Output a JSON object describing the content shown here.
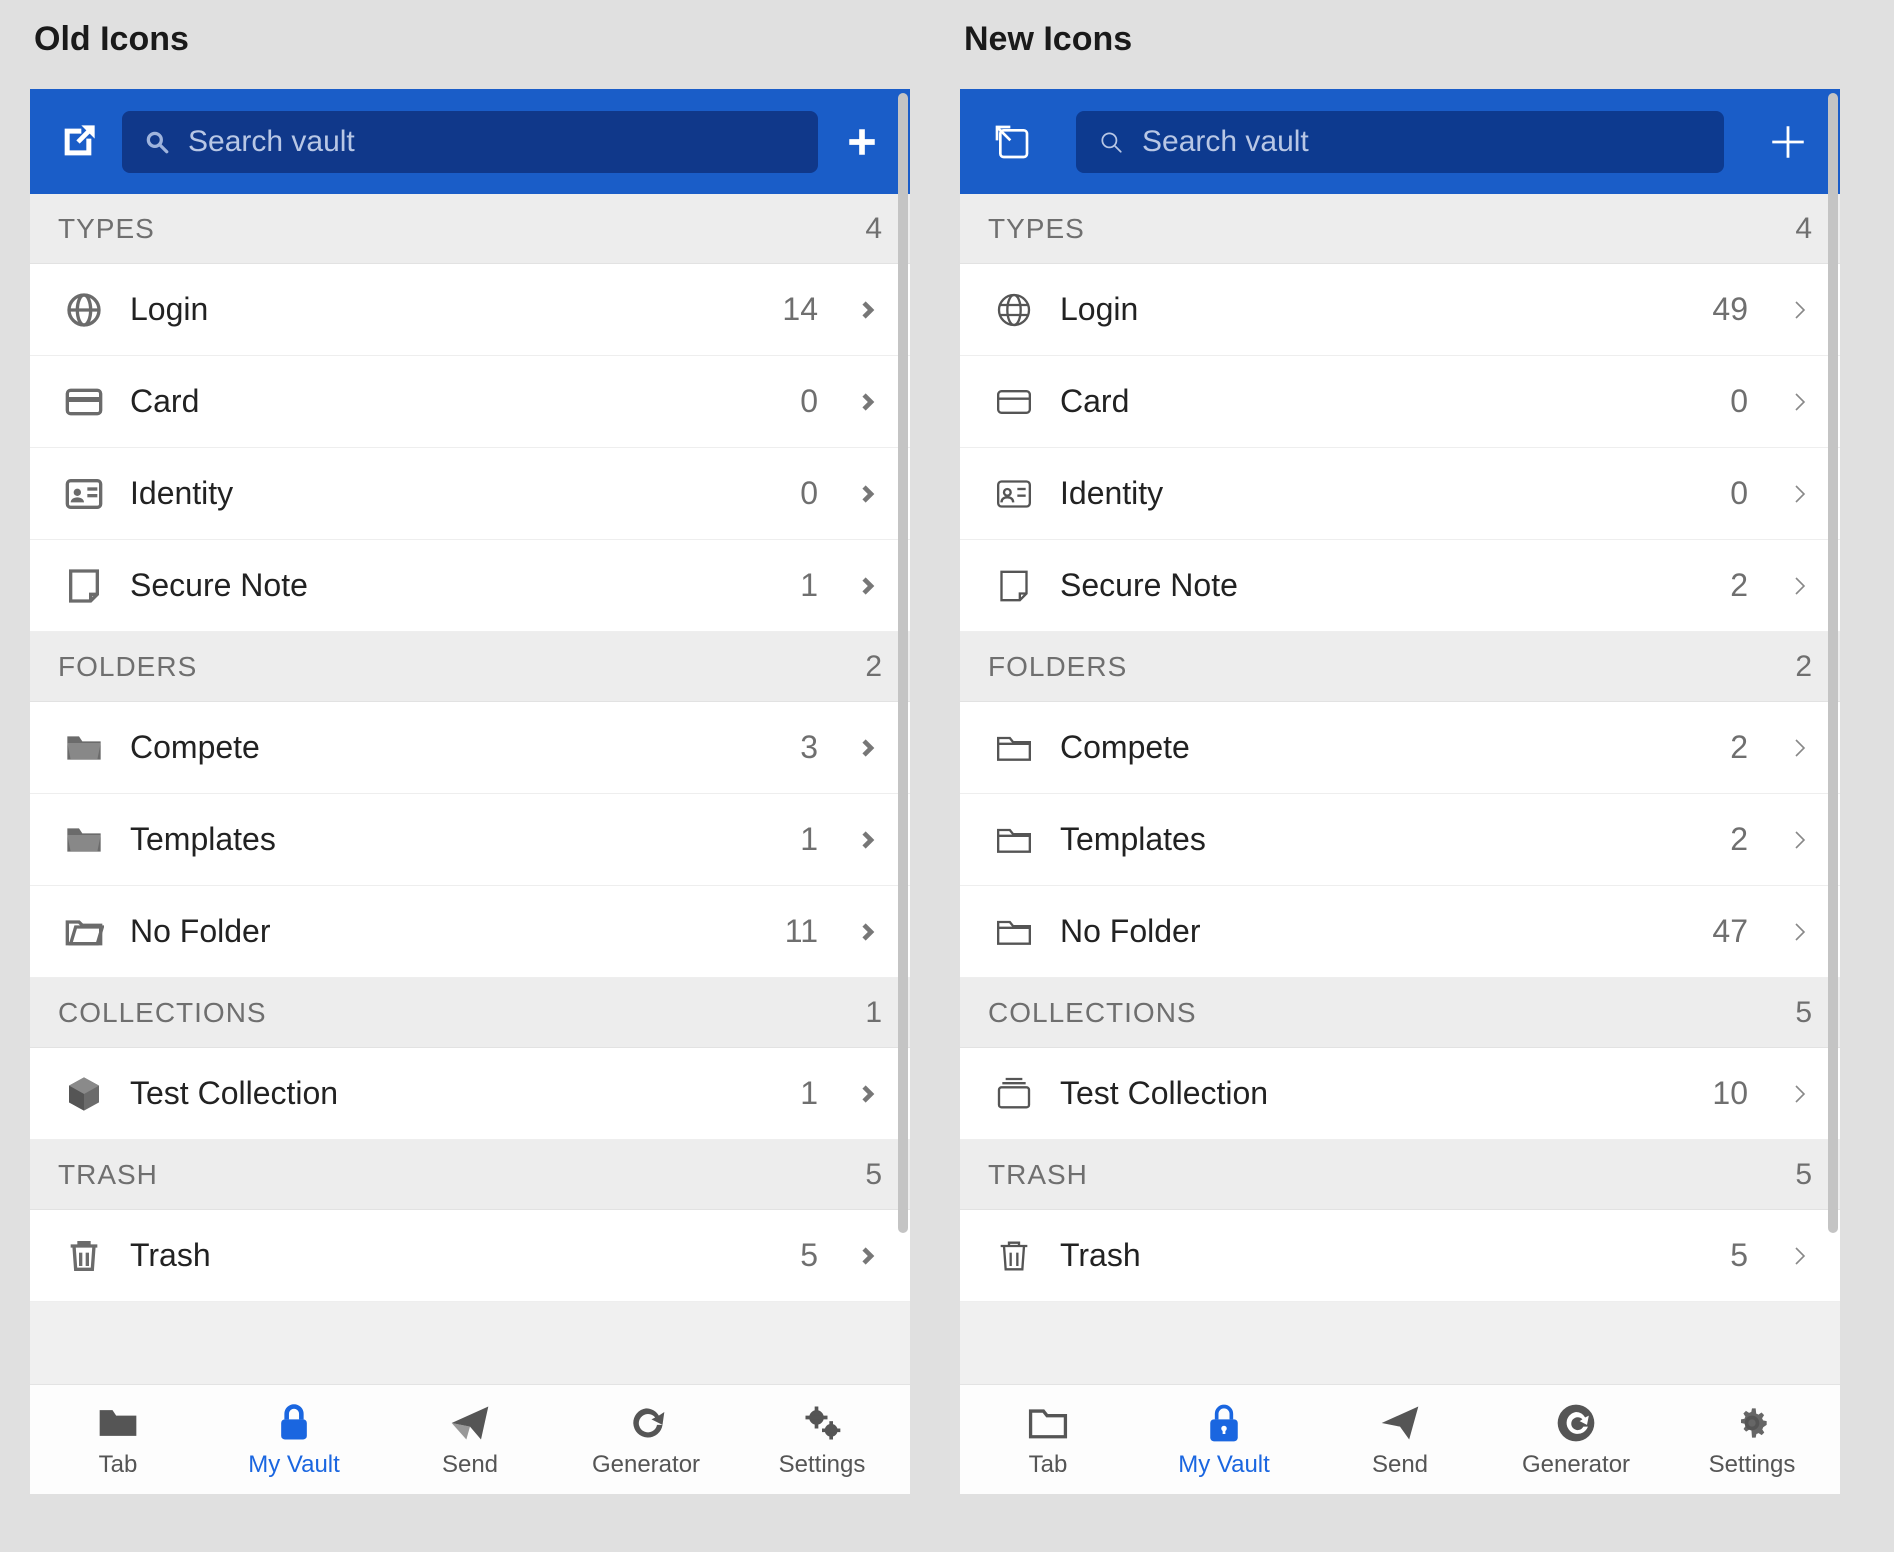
{
  "titles": {
    "old": "Old Icons",
    "new": "New Icons"
  },
  "search_placeholder": "Search vault",
  "sections": {
    "types": "TYPES",
    "folders": "FOLDERS",
    "collections": "COLLECTIONS",
    "trash": "TRASH"
  },
  "old": {
    "types_count": "4",
    "folders_count": "2",
    "collections_count": "1",
    "trash_count": "5",
    "types": {
      "login": {
        "label": "Login",
        "count": "14"
      },
      "card": {
        "label": "Card",
        "count": "0"
      },
      "identity": {
        "label": "Identity",
        "count": "0"
      },
      "secure": {
        "label": "Secure Note",
        "count": "1"
      }
    },
    "folders": {
      "compete": {
        "label": "Compete",
        "count": "3"
      },
      "templates": {
        "label": "Templates",
        "count": "1"
      },
      "nofolder": {
        "label": "No Folder",
        "count": "11"
      }
    },
    "collections": {
      "test": {
        "label": "Test Collection",
        "count": "1"
      }
    },
    "trash": {
      "label": "Trash",
      "count": "5"
    }
  },
  "new": {
    "types_count": "4",
    "folders_count": "2",
    "collections_count": "5",
    "trash_count": "5",
    "types": {
      "login": {
        "label": "Login",
        "count": "49"
      },
      "card": {
        "label": "Card",
        "count": "0"
      },
      "identity": {
        "label": "Identity",
        "count": "0"
      },
      "secure": {
        "label": "Secure Note",
        "count": "2"
      }
    },
    "folders": {
      "compete": {
        "label": "Compete",
        "count": "2"
      },
      "templates": {
        "label": "Templates",
        "count": "2"
      },
      "nofolder": {
        "label": "No Folder",
        "count": "47"
      }
    },
    "collections": {
      "test": {
        "label": "Test Collection",
        "count": "10"
      }
    },
    "trash": {
      "label": "Trash",
      "count": "5"
    }
  },
  "tabs": {
    "tab": "Tab",
    "vault": "My Vault",
    "send": "Send",
    "generator": "Generator",
    "settings": "Settings"
  }
}
